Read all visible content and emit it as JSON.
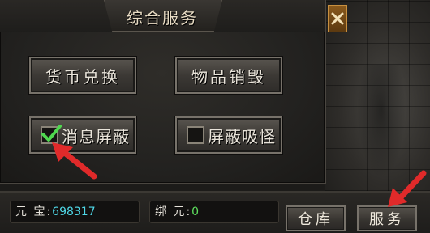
{
  "panel": {
    "title": "综合服务",
    "close_icon": "close-icon",
    "buttons": {
      "currency_exchange": "货币兑换",
      "item_destroy": "物品销毁",
      "block_messages": "消息屏蔽",
      "block_monsters": "屏蔽吸怪"
    },
    "block_messages_checked": true,
    "block_monsters_checked": false
  },
  "bottom_bar": {
    "yuanbao_label": "元 宝:",
    "yuanbao_value": "698317",
    "bound_yuanbao_label": "绑 元:",
    "bound_yuanbao_value": "0",
    "warehouse_button": "仓库",
    "service_button": "服务"
  },
  "colors": {
    "accent_arrow": "#e02a2a",
    "check_green": "#4fd84f",
    "value_cyan": "#4fd8e8",
    "value_green": "#5ee05e"
  }
}
